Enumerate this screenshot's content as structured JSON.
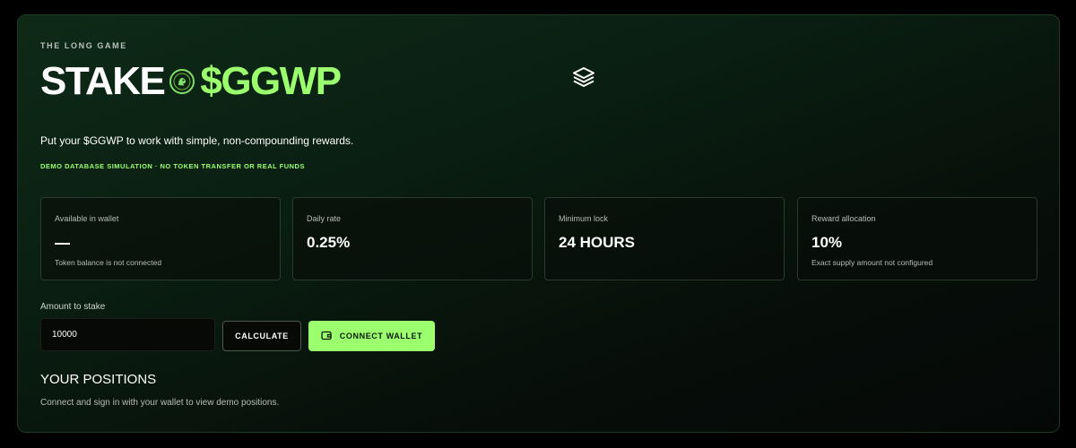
{
  "header": {
    "eyebrow": "THE LONG GAME",
    "title_prefix": "STAKE",
    "title_token": "$GGWP",
    "coin_icon": "ggwp-coin-logo",
    "layers_icon": "layers-icon"
  },
  "subtitle": "Put your $GGWP to work with simple, non-compounding rewards.",
  "demo_note": "DEMO DATABASE SIMULATION · NO TOKEN TRANSFER OR REAL FUNDS",
  "stats": [
    {
      "label": "Available in wallet",
      "value": "—",
      "note": "Token balance is not connected"
    },
    {
      "label": "Daily rate",
      "value": "0.25%",
      "note": ""
    },
    {
      "label": "Minimum lock",
      "value": "24 HOURS",
      "note": ""
    },
    {
      "label": "Reward allocation",
      "value": "10%",
      "note": "Exact supply amount not configured"
    }
  ],
  "stake": {
    "amount_label": "Amount to stake",
    "amount_value": "10000",
    "calculate_label": "CALCULATE",
    "connect_label": "CONNECT WALLET",
    "wallet_icon": "wallet-icon"
  },
  "positions": {
    "title": "YOUR POSITIONS",
    "note": "Connect and sign in with your wallet to view demo positions."
  },
  "colors": {
    "accent": "#9cff6e",
    "background": "#0a1f12",
    "border": "#2a3a2c"
  }
}
